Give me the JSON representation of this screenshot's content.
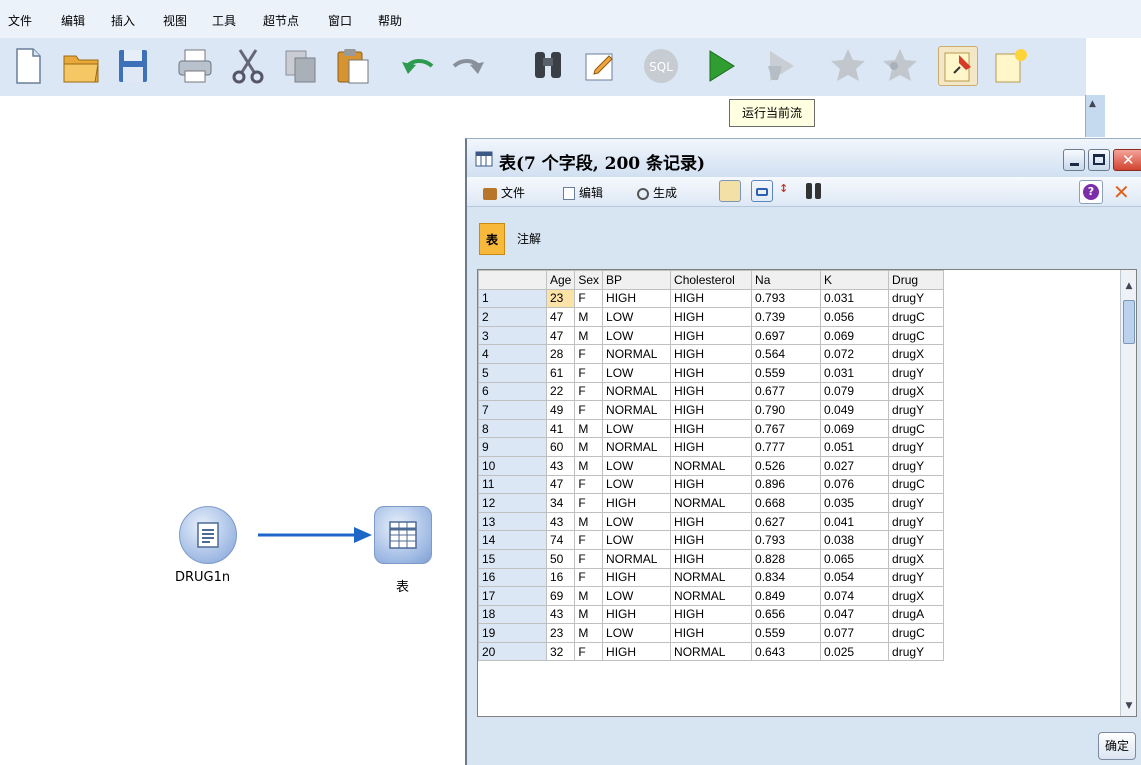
{
  "menu": [
    "文件",
    "编辑",
    "插入",
    "视图",
    "工具",
    "超节点",
    "窗口",
    "帮助"
  ],
  "toolbar_icons": [
    "new-file-icon",
    "open-folder-icon",
    "save-icon",
    "print-icon",
    "cut-icon",
    "copy-icon",
    "paste-icon",
    "undo-icon",
    "redo-icon",
    "find-icon",
    "edit-icon",
    "sql-icon",
    "run-icon",
    "run-selection-icon",
    "star-icon",
    "star-multi-icon",
    "pin-icon",
    "new-note-icon"
  ],
  "tooltip": "运行当前流",
  "canvas": {
    "source_node": {
      "label": "DRUG1n"
    },
    "table_node": {
      "label": "表"
    }
  },
  "table_window": {
    "title": "表(7 个字段, 200 条记录)",
    "menus": [
      "文件",
      "编辑",
      "生成"
    ],
    "tabs": [
      "表",
      "注解"
    ],
    "ok_label": "确定",
    "columns": [
      "",
      "Age",
      "Sex",
      "BP",
      "Cholesterol",
      "Na",
      "K",
      "Drug"
    ],
    "rows": [
      [
        "1",
        "23",
        "F",
        "HIGH",
        "HIGH",
        "0.793",
        "0.031",
        "drugY"
      ],
      [
        "2",
        "47",
        "M",
        "LOW",
        "HIGH",
        "0.739",
        "0.056",
        "drugC"
      ],
      [
        "3",
        "47",
        "M",
        "LOW",
        "HIGH",
        "0.697",
        "0.069",
        "drugC"
      ],
      [
        "4",
        "28",
        "F",
        "NORMAL",
        "HIGH",
        "0.564",
        "0.072",
        "drugX"
      ],
      [
        "5",
        "61",
        "F",
        "LOW",
        "HIGH",
        "0.559",
        "0.031",
        "drugY"
      ],
      [
        "6",
        "22",
        "F",
        "NORMAL",
        "HIGH",
        "0.677",
        "0.079",
        "drugX"
      ],
      [
        "7",
        "49",
        "F",
        "NORMAL",
        "HIGH",
        "0.790",
        "0.049",
        "drugY"
      ],
      [
        "8",
        "41",
        "M",
        "LOW",
        "HIGH",
        "0.767",
        "0.069",
        "drugC"
      ],
      [
        "9",
        "60",
        "M",
        "NORMAL",
        "HIGH",
        "0.777",
        "0.051",
        "drugY"
      ],
      [
        "10",
        "43",
        "M",
        "LOW",
        "NORMAL",
        "0.526",
        "0.027",
        "drugY"
      ],
      [
        "11",
        "47",
        "F",
        "LOW",
        "HIGH",
        "0.896",
        "0.076",
        "drugC"
      ],
      [
        "12",
        "34",
        "F",
        "HIGH",
        "NORMAL",
        "0.668",
        "0.035",
        "drugY"
      ],
      [
        "13",
        "43",
        "M",
        "LOW",
        "HIGH",
        "0.627",
        "0.041",
        "drugY"
      ],
      [
        "14",
        "74",
        "F",
        "LOW",
        "HIGH",
        "0.793",
        "0.038",
        "drugY"
      ],
      [
        "15",
        "50",
        "F",
        "NORMAL",
        "HIGH",
        "0.828",
        "0.065",
        "drugX"
      ],
      [
        "16",
        "16",
        "F",
        "HIGH",
        "NORMAL",
        "0.834",
        "0.054",
        "drugY"
      ],
      [
        "17",
        "69",
        "M",
        "LOW",
        "NORMAL",
        "0.849",
        "0.074",
        "drugX"
      ],
      [
        "18",
        "43",
        "M",
        "HIGH",
        "HIGH",
        "0.656",
        "0.047",
        "drugA"
      ],
      [
        "19",
        "23",
        "M",
        "LOW",
        "HIGH",
        "0.559",
        "0.077",
        "drugC"
      ],
      [
        "20",
        "32",
        "F",
        "HIGH",
        "NORMAL",
        "0.643",
        "0.025",
        "drugY"
      ]
    ]
  },
  "colors": {
    "menubar_bg": "#ebf2fa",
    "toolbar_bg": "#dbe7f5",
    "active_tab": "#f8b83a",
    "connector": "#1e66c7"
  }
}
